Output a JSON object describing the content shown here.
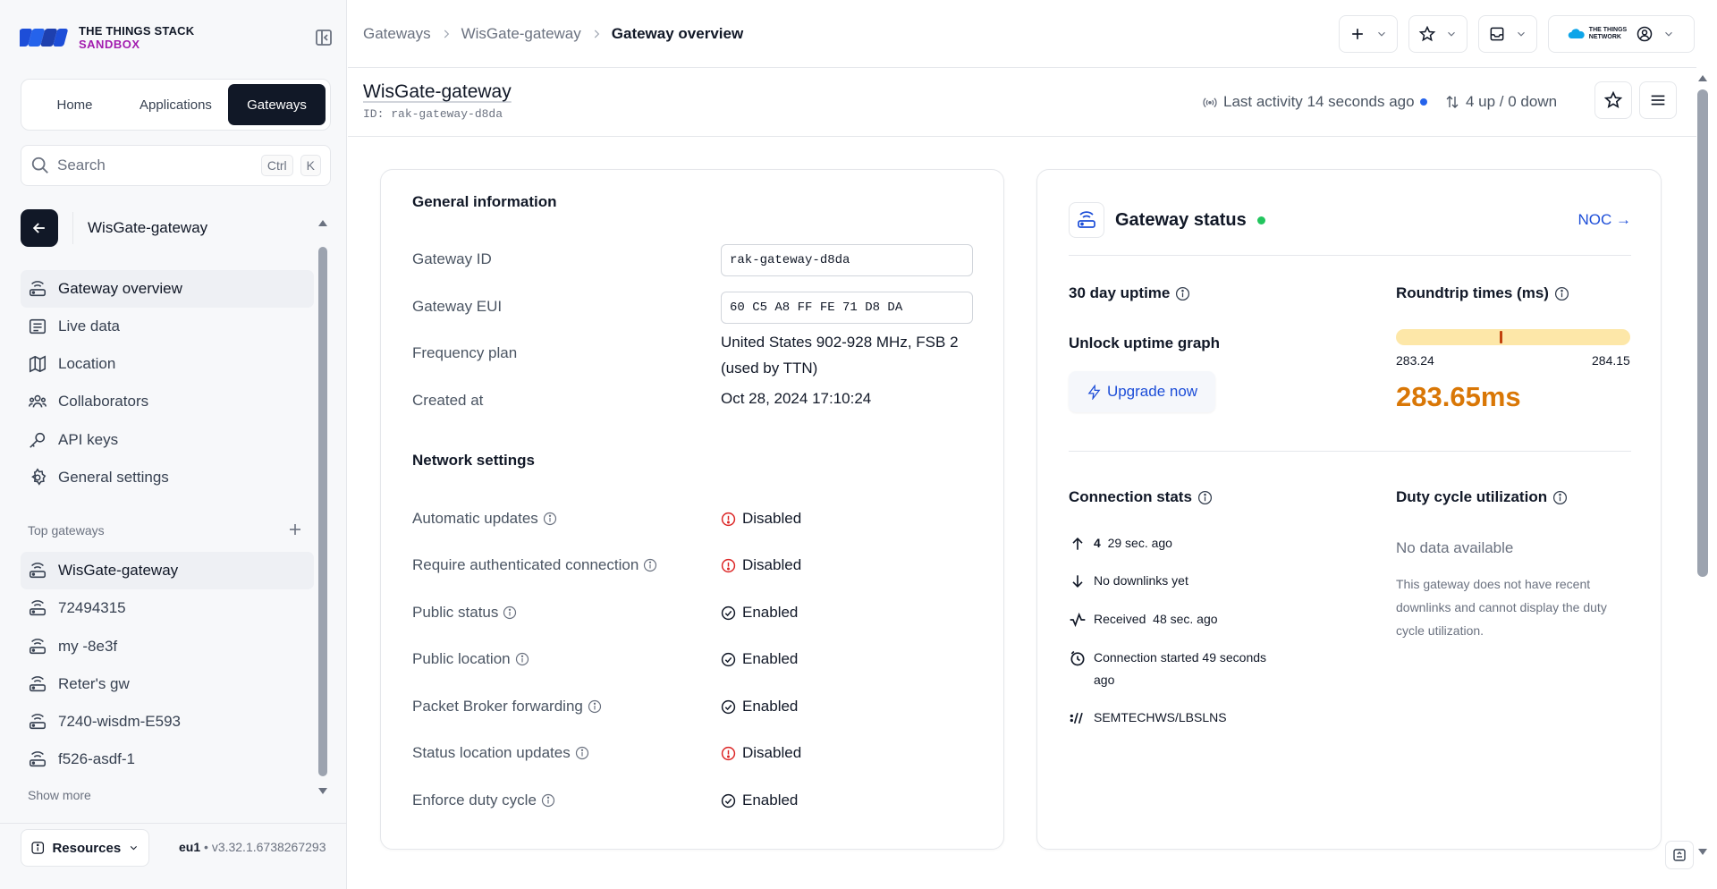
{
  "logo": {
    "line1": "THE THINGS STACK",
    "line2": "SANDBOX",
    "brand_color": "#a21caf"
  },
  "nav_tabs": [
    {
      "label": "Home",
      "active": false
    },
    {
      "label": "Applications",
      "active": false
    },
    {
      "label": "Gateways",
      "active": true
    }
  ],
  "search": {
    "placeholder": "Search",
    "shortcut_keys": [
      "Ctrl",
      "K"
    ]
  },
  "sidebar": {
    "gateway_title": "WisGate-gateway",
    "menu": [
      {
        "label": "Gateway overview",
        "icon": "gateway-icon",
        "active": true
      },
      {
        "label": "Live data",
        "icon": "list-icon",
        "active": false
      },
      {
        "label": "Location",
        "icon": "map-icon",
        "active": false
      },
      {
        "label": "Collaborators",
        "icon": "users-icon",
        "active": false
      },
      {
        "label": "API keys",
        "icon": "key-icon",
        "active": false
      },
      {
        "label": "General settings",
        "icon": "gear-icon",
        "active": false
      }
    ],
    "top_gateways_label": "Top gateways",
    "top_gateways": [
      {
        "label": "WisGate-gateway",
        "active": true
      },
      {
        "label": "72494315",
        "active": false
      },
      {
        "label": "my -8e3f",
        "active": false
      },
      {
        "label": "Reter's gw",
        "active": false
      },
      {
        "label": "7240-wisdm-E593",
        "active": false
      },
      {
        "label": "f526-asdf-1",
        "active": false
      }
    ],
    "show_more": "Show more",
    "resources_label": "Resources",
    "cluster": "eu1",
    "version": "v3.32.1.6738267293"
  },
  "breadcrumb": [
    "Gateways",
    "WisGate-gateway",
    "Gateway overview"
  ],
  "header": {
    "title": "WisGate-gateway",
    "id_label": "ID:",
    "id_value": "rak-gateway-d8da",
    "last_activity": "Last activity 14 seconds ago",
    "up_down": "4 up / 0 down"
  },
  "general_info": {
    "title": "General information",
    "gateway_id_label": "Gateway ID",
    "gateway_id_value": "rak-gateway-d8da",
    "gateway_eui_label": "Gateway EUI",
    "gateway_eui_value": "60 C5 A8 FF FE 71 D8 DA",
    "frequency_plan_label": "Frequency plan",
    "frequency_plan_line1": "United States 902-928 MHz, FSB 2",
    "frequency_plan_line2": "(used by TTN)",
    "created_at_label": "Created at",
    "created_at_value": "Oct 28, 2024 17:10:24"
  },
  "network_settings": {
    "title": "Network settings",
    "rows": [
      {
        "label": "Automatic updates",
        "value": "Disabled",
        "state": "disabled"
      },
      {
        "label": "Require authenticated connection",
        "value": "Disabled",
        "state": "disabled"
      },
      {
        "label": "Public status",
        "value": "Enabled",
        "state": "enabled"
      },
      {
        "label": "Public location",
        "value": "Enabled",
        "state": "enabled"
      },
      {
        "label": "Packet Broker forwarding",
        "value": "Enabled",
        "state": "enabled"
      },
      {
        "label": "Status location updates",
        "value": "Disabled",
        "state": "disabled"
      },
      {
        "label": "Enforce duty cycle",
        "value": "Enabled",
        "state": "enabled"
      }
    ],
    "disabled_color": "#dc2626",
    "enabled_color": "#111827"
  },
  "gateway_status": {
    "title": "Gateway status",
    "noc_link": "NOC →",
    "uptime_title": "30 day uptime",
    "unlock_title": "Unlock uptime graph",
    "upgrade_label": "Upgrade now",
    "roundtrip_title": "Roundtrip times (ms)",
    "roundtrip_min": "283.24",
    "roundtrip_max": "284.15",
    "roundtrip_value": "283.65ms",
    "roundtrip_marker_fraction": 0.45,
    "connection_title": "Connection stats",
    "uplinks_count": "4",
    "uplinks_time": "29 sec. ago",
    "downlinks": "No downlinks yet",
    "received_label": "Received",
    "received_time": "48 sec. ago",
    "connection_started_line1": "Connection started 49 seconds",
    "connection_started_line2": "ago",
    "protocol": "SEMTECHWS/LBSLNS",
    "duty_title": "Duty cycle utilization",
    "no_data": "No data available",
    "no_data_desc": "This gateway does not have recent downlinks and cannot display the duty cycle utilization."
  }
}
